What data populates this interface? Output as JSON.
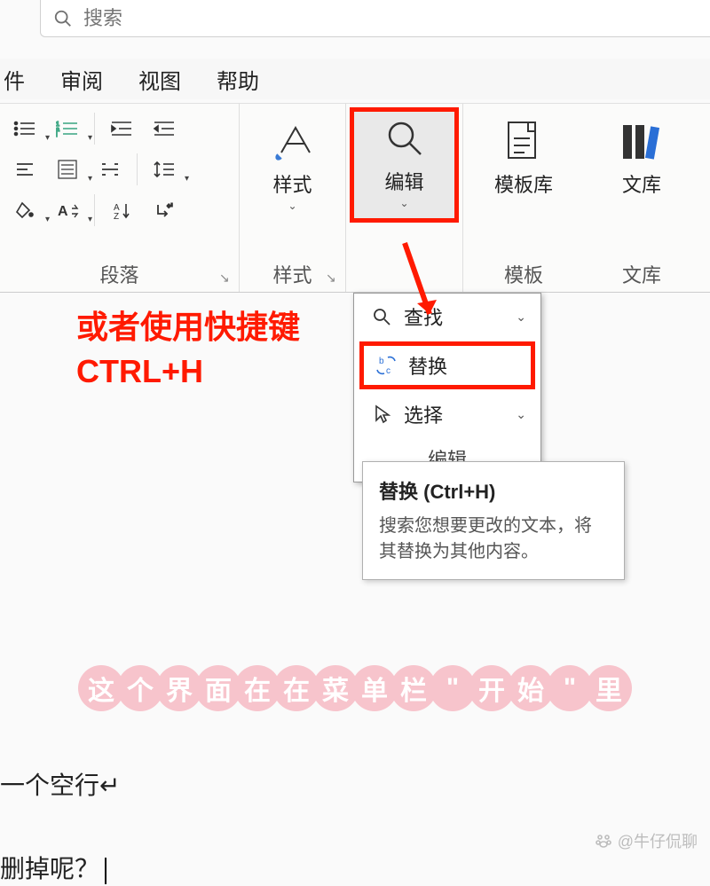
{
  "search": {
    "placeholder": "搜索"
  },
  "tabs": {
    "t0": "件",
    "t1": "审阅",
    "t2": "视图",
    "t3": "帮助"
  },
  "ribbon": {
    "paragraph_label": "段落",
    "styles_label": "样式",
    "styles_btn": "样式",
    "edit_btn": "编辑",
    "template_btn": "模板库",
    "template_label": "模板",
    "lib_btn": "文库",
    "lib_label": "文库"
  },
  "edit_menu": {
    "find": "查找",
    "replace": "替换",
    "select": "选择",
    "footer": "编辑"
  },
  "tooltip": {
    "title": "替换 (Ctrl+H)",
    "body": "搜索您想要更改的文本，将其替换为其他内容。"
  },
  "annotation": {
    "line1": "或者使用快捷键",
    "line2": "CTRL+H"
  },
  "pink_caption": "这个界面在在菜单栏\"开始\"里",
  "doc": {
    "line1": "一个空行↵",
    "line2": "删掉呢？"
  },
  "watermark": "@牛仔侃聊"
}
